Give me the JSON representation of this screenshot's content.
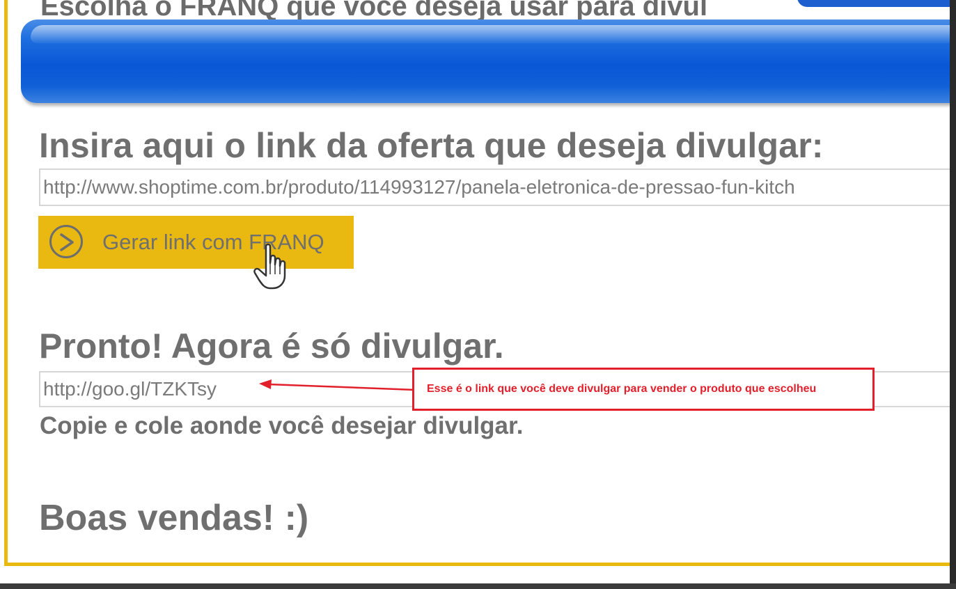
{
  "page": {
    "top_heading": "Escolha o FRANQ que você deseja usar para divul",
    "offer_heading": "Insira aqui o link da oferta que deseja divulgar:",
    "offer_input_value": "http://www.shoptime.com.br/produto/114993127/panela-eletronica-de-pressao-fun-kitch",
    "generate_button_label": "Gerar link com FRANQ",
    "ready_heading": "Pronto! Agora é só divulgar.",
    "short_link_value": "http://goo.gl/TZKTsy",
    "copy_instruction": "Copie e cole aonde você desejar divulgar.",
    "sales_heading": "Boas vendas! :)"
  },
  "annotation": {
    "text": "Esse é o link que você deve divulgar para vender o produto que escolheu",
    "color": "#e2202b"
  },
  "icons": {
    "generate_icon": "chevron-circle-right-icon",
    "cursor": "hand-pointer-icon"
  },
  "colors": {
    "accent_gold": "#e9b911",
    "banner_blue": "#0a57d6",
    "heading_gray": "#6f6f6f"
  }
}
